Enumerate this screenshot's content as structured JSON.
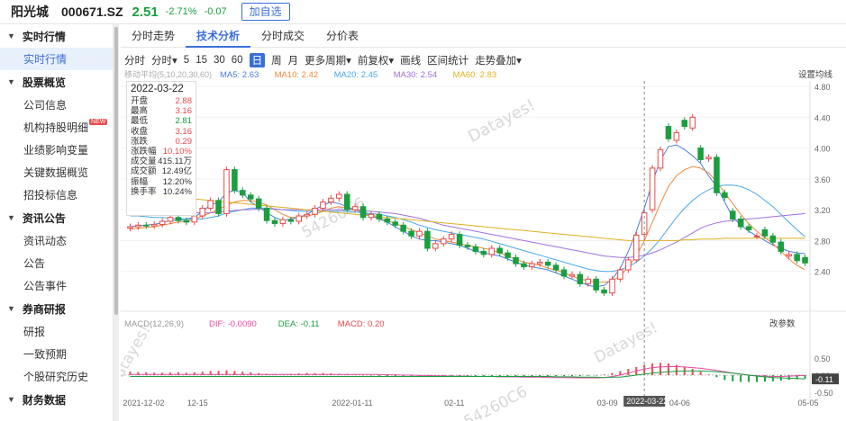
{
  "header": {
    "name": "阳光城",
    "code": "000671.SZ",
    "price": "2.51",
    "change_pct": "-2.71%",
    "change": "-0.07",
    "add_label": "加自选",
    "colors": {
      "down": "#1a9e3f",
      "up": "#e84a4a",
      "accent": "#3b6fd8"
    }
  },
  "sidebar": {
    "sections": [
      {
        "title": "实时行情",
        "items": [
          {
            "label": "实时行情",
            "active": true
          }
        ]
      },
      {
        "title": "股票概览",
        "items": [
          {
            "label": "公司信息"
          },
          {
            "label": "机构持股明细",
            "badge": "NEW"
          },
          {
            "label": "业绩影响变量"
          },
          {
            "label": "关键数据概览"
          },
          {
            "label": "招投标信息"
          }
        ]
      },
      {
        "title": "资讯公告",
        "items": [
          {
            "label": "资讯动态"
          },
          {
            "label": "公告"
          },
          {
            "label": "公告事件"
          }
        ]
      },
      {
        "title": "券商研报",
        "items": [
          {
            "label": "研报"
          },
          {
            "label": "一致预期"
          },
          {
            "label": "个股研究历史"
          }
        ]
      },
      {
        "title": "财务数据",
        "items": []
      }
    ]
  },
  "tabs": [
    {
      "label": "分时走势"
    },
    {
      "label": "技术分析",
      "active": true
    },
    {
      "label": "分时成交"
    },
    {
      "label": "分价表"
    }
  ],
  "periods": [
    {
      "label": "分时"
    },
    {
      "label": "分时▾"
    },
    {
      "label": "5"
    },
    {
      "label": "15"
    },
    {
      "label": "30"
    },
    {
      "label": "60"
    },
    {
      "label": "日",
      "active": true
    },
    {
      "label": "周"
    },
    {
      "label": "月"
    },
    {
      "label": "更多周期▾"
    },
    {
      "label": "前复权▾"
    },
    {
      "label": "画线"
    },
    {
      "label": "区间统计"
    },
    {
      "label": "走势叠加▾"
    }
  ],
  "ma_legend": {
    "label": "移动平均(5,10,20,30,60)",
    "items": [
      {
        "text": "MA5: 2.63",
        "color": "#4a7fd6"
      },
      {
        "text": "MA10: 2.42",
        "color": "#f0883a"
      },
      {
        "text": "MA20: 2.45",
        "color": "#4aa8e8"
      },
      {
        "text": "MA30: 2.54",
        "color": "#a070e0"
      },
      {
        "text": "MA60: 2.83",
        "color": "#e0b020"
      }
    ]
  },
  "settings_label": "设置均线",
  "macd_legend": {
    "label": "MACD(12,26,9)",
    "items": [
      {
        "text": "DIF: -0.0090",
        "color": "#e84aa0"
      },
      {
        "text": "DEA: -0.11",
        "color": "#1a9e3f"
      },
      {
        "text": "MACD: 0.20",
        "color": "#e84a4a"
      }
    ]
  },
  "change_params_label": "改参数",
  "watermark": "Datayes!",
  "watermark_id": "54260C6",
  "crosshair_date": "2022-03-22",
  "macd_readout": "-0.11",
  "infobox": {
    "date": "2022-03-22",
    "rows": [
      {
        "k": "开盘",
        "v": "2.88",
        "c": "r"
      },
      {
        "k": "最高",
        "v": "3.16",
        "c": "r"
      },
      {
        "k": "最低",
        "v": "2.81",
        "c": "g"
      },
      {
        "k": "收盘",
        "v": "3.16",
        "c": "r"
      },
      {
        "k": "涨跌",
        "v": "0.29",
        "c": "r"
      },
      {
        "k": "涨跌幅",
        "v": "10.10%",
        "c": "r"
      },
      {
        "k": "成交量",
        "v": "415.11万",
        "c": "k"
      },
      {
        "k": "成交额",
        "v": "12.49亿",
        "c": "k"
      },
      {
        "k": "振幅",
        "v": "12.20%",
        "c": "k"
      },
      {
        "k": "换手率",
        "v": "10.24%",
        "c": "k"
      }
    ]
  },
  "chart_data": {
    "type": "candlestick",
    "price_axis": {
      "min": 2.0,
      "max": 4.8,
      "ticks": [
        "4.80",
        "4.40",
        "4.00",
        "3.60",
        "3.20",
        "2.80",
        "2.40"
      ]
    },
    "macd_axis": {
      "min": -0.5,
      "max": 0.5,
      "ticks": [
        "0.50",
        "0.00",
        "-0.50"
      ]
    },
    "x_ticks": [
      {
        "i": 0,
        "label": "2021-12-02"
      },
      {
        "i": 8,
        "label": "12-15"
      },
      {
        "i": 26,
        "label": "2022-01-11"
      },
      {
        "i": 40,
        "label": "02-11"
      },
      {
        "i": 59,
        "label": "03-09"
      },
      {
        "i": 68,
        "label": "04-06"
      },
      {
        "i": 84,
        "label": "05-05"
      }
    ],
    "crosshair_index": 64,
    "closes": [
      2.98,
      3.0,
      2.99,
      3.01,
      3.05,
      3.1,
      3.06,
      3.04,
      3.12,
      3.22,
      3.32,
      3.15,
      3.72,
      3.45,
      3.39,
      3.34,
      3.22,
      3.06,
      3.02,
      3.07,
      3.05,
      3.12,
      3.14,
      3.22,
      3.3,
      3.35,
      3.4,
      3.2,
      3.24,
      3.1,
      3.14,
      3.08,
      3.04,
      3.0,
      2.92,
      2.86,
      2.92,
      2.7,
      2.76,
      2.82,
      2.88,
      2.74,
      2.72,
      2.66,
      2.62,
      2.7,
      2.64,
      2.58,
      2.5,
      2.46,
      2.5,
      2.52,
      2.48,
      2.42,
      2.34,
      2.36,
      2.24,
      2.3,
      2.16,
      2.12,
      2.3,
      2.42,
      2.55,
      2.87,
      3.16,
      3.74,
      3.98,
      4.12,
      4.2,
      4.28,
      4.4,
      3.85,
      3.88,
      3.42,
      3.36,
      3.08,
      2.98,
      2.94,
      2.86,
      2.86,
      2.78,
      2.66,
      2.62,
      2.54,
      2.51
    ],
    "opens": [
      2.96,
      2.98,
      3.0,
      2.99,
      3.01,
      3.05,
      3.1,
      3.06,
      3.04,
      3.12,
      3.22,
      3.32,
      3.15,
      3.72,
      3.45,
      3.39,
      3.34,
      3.22,
      3.06,
      3.02,
      3.07,
      3.05,
      3.12,
      3.14,
      3.22,
      3.3,
      3.35,
      3.4,
      3.2,
      3.24,
      3.1,
      3.14,
      3.08,
      3.04,
      3.0,
      2.92,
      2.86,
      2.92,
      2.7,
      2.76,
      2.82,
      2.88,
      2.74,
      2.72,
      2.66,
      2.62,
      2.7,
      2.64,
      2.58,
      2.5,
      2.46,
      2.5,
      2.52,
      2.48,
      2.42,
      2.34,
      2.36,
      2.24,
      2.3,
      2.16,
      2.12,
      2.3,
      2.42,
      2.55,
      2.88,
      3.2,
      3.74,
      4.28,
      4.1,
      4.36,
      4.26,
      4.0,
      3.86,
      3.88,
      3.42,
      3.18,
      3.08,
      2.98,
      2.86,
      2.94,
      2.86,
      2.78,
      2.6,
      2.62,
      2.58
    ],
    "ma_series": [
      {
        "color": "#4a7fd6",
        "values": [
          2.98,
          2.99,
          3.0,
          3.01,
          3.03,
          3.06,
          3.06,
          3.08,
          3.1,
          3.18,
          3.26,
          3.3,
          3.42,
          3.45,
          3.42,
          3.3,
          3.24,
          3.16,
          3.1,
          3.06,
          3.08,
          3.1,
          3.14,
          3.2,
          3.26,
          3.3,
          3.28,
          3.24,
          3.2,
          3.16,
          3.12,
          3.08,
          3.04,
          2.98,
          2.92,
          2.86,
          2.82,
          2.8,
          2.8,
          2.78,
          2.76,
          2.74,
          2.7,
          2.66,
          2.64,
          2.62,
          2.6,
          2.56,
          2.52,
          2.48,
          2.46,
          2.44,
          2.42,
          2.38,
          2.34,
          2.3,
          2.26,
          2.22,
          2.2,
          2.22,
          2.3,
          2.44,
          2.66,
          2.92,
          3.22,
          3.56,
          3.84,
          4.02,
          4.04,
          3.98,
          3.9,
          3.8,
          3.64,
          3.5,
          3.3,
          3.1,
          3.0,
          2.92,
          2.86,
          2.8,
          2.74,
          2.7,
          2.66,
          2.64,
          2.63
        ]
      },
      {
        "color": "#f0883a",
        "values": [
          2.95,
          2.96,
          2.97,
          2.98,
          3.0,
          3.02,
          3.04,
          3.05,
          3.07,
          3.12,
          3.16,
          3.2,
          3.26,
          3.3,
          3.32,
          3.32,
          3.3,
          3.26,
          3.2,
          3.14,
          3.1,
          3.1,
          3.12,
          3.14,
          3.18,
          3.22,
          3.24,
          3.22,
          3.2,
          3.18,
          3.14,
          3.1,
          3.06,
          3.02,
          2.98,
          2.94,
          2.9,
          2.86,
          2.82,
          2.8,
          2.78,
          2.76,
          2.74,
          2.72,
          2.7,
          2.68,
          2.64,
          2.6,
          2.56,
          2.52,
          2.5,
          2.48,
          2.44,
          2.42,
          2.38,
          2.34,
          2.3,
          2.28,
          2.26,
          2.26,
          2.28,
          2.34,
          2.46,
          2.6,
          2.8,
          3.04,
          3.28,
          3.5,
          3.64,
          3.72,
          3.76,
          3.74,
          3.68,
          3.56,
          3.42,
          3.28,
          3.14,
          3.02,
          2.92,
          2.84,
          2.76,
          2.66,
          2.56,
          2.48,
          2.42
        ]
      },
      {
        "color": "#4aa8e8",
        "values": [
          3.12,
          3.12,
          3.11,
          3.1,
          3.1,
          3.09,
          3.08,
          3.08,
          3.07,
          3.08,
          3.1,
          3.12,
          3.16,
          3.18,
          3.2,
          3.22,
          3.22,
          3.22,
          3.21,
          3.2,
          3.19,
          3.18,
          3.18,
          3.18,
          3.18,
          3.18,
          3.18,
          3.18,
          3.17,
          3.16,
          3.15,
          3.14,
          3.12,
          3.1,
          3.07,
          3.04,
          3.0,
          2.97,
          2.94,
          2.92,
          2.9,
          2.88,
          2.86,
          2.84,
          2.82,
          2.79,
          2.76,
          2.73,
          2.7,
          2.67,
          2.64,
          2.61,
          2.58,
          2.55,
          2.52,
          2.49,
          2.46,
          2.43,
          2.41,
          2.4,
          2.4,
          2.42,
          2.46,
          2.52,
          2.6,
          2.7,
          2.82,
          2.96,
          3.1,
          3.22,
          3.32,
          3.4,
          3.46,
          3.5,
          3.52,
          3.52,
          3.5,
          3.46,
          3.4,
          3.32,
          3.24,
          3.14,
          3.04,
          2.94,
          2.85
        ]
      },
      {
        "color": "#a070e0",
        "values": [
          3.2,
          3.2,
          3.19,
          3.19,
          3.18,
          3.18,
          3.17,
          3.17,
          3.16,
          3.16,
          3.16,
          3.17,
          3.18,
          3.19,
          3.2,
          3.2,
          3.21,
          3.21,
          3.21,
          3.2,
          3.2,
          3.2,
          3.2,
          3.2,
          3.2,
          3.2,
          3.2,
          3.2,
          3.2,
          3.19,
          3.18,
          3.17,
          3.16,
          3.15,
          3.13,
          3.11,
          3.09,
          3.06,
          3.03,
          3.0,
          2.98,
          2.96,
          2.94,
          2.92,
          2.9,
          2.88,
          2.86,
          2.84,
          2.82,
          2.8,
          2.78,
          2.76,
          2.74,
          2.72,
          2.7,
          2.68,
          2.66,
          2.64,
          2.62,
          2.6,
          2.59,
          2.58,
          2.58,
          2.59,
          2.61,
          2.64,
          2.68,
          2.73,
          2.78,
          2.84,
          2.9,
          2.96,
          3.0,
          3.03,
          3.05,
          3.06,
          3.07,
          3.08,
          3.09,
          3.1,
          3.11,
          3.12,
          3.13,
          3.14,
          3.15
        ]
      },
      {
        "color": "#e0b020",
        "values": [
          3.42,
          3.41,
          3.4,
          3.39,
          3.38,
          3.37,
          3.36,
          3.35,
          3.34,
          3.33,
          3.32,
          3.31,
          3.3,
          3.29,
          3.28,
          3.27,
          3.26,
          3.25,
          3.24,
          3.23,
          3.22,
          3.21,
          3.2,
          3.19,
          3.18,
          3.17,
          3.16,
          3.15,
          3.14,
          3.13,
          3.12,
          3.11,
          3.1,
          3.09,
          3.08,
          3.07,
          3.06,
          3.05,
          3.04,
          3.03,
          3.02,
          3.01,
          3.0,
          2.99,
          2.98,
          2.97,
          2.96,
          2.95,
          2.94,
          2.93,
          2.92,
          2.91,
          2.9,
          2.89,
          2.88,
          2.87,
          2.86,
          2.85,
          2.84,
          2.83,
          2.82,
          2.81,
          2.8,
          2.8,
          2.8,
          2.8,
          2.8,
          2.8,
          2.8,
          2.81,
          2.81,
          2.82,
          2.82,
          2.82,
          2.83,
          2.83,
          2.83,
          2.83,
          2.83,
          2.83,
          2.83,
          2.83,
          2.83,
          2.83,
          2.83
        ]
      }
    ],
    "macd_hist": [
      0.1,
      0.09,
      0.08,
      0.07,
      0.07,
      0.08,
      0.08,
      0.07,
      0.08,
      0.1,
      0.12,
      0.12,
      0.14,
      0.12,
      0.1,
      0.08,
      0.06,
      0.04,
      0.03,
      0.03,
      0.04,
      0.05,
      0.06,
      0.06,
      0.06,
      0.05,
      0.04,
      0.03,
      0.02,
      0.0,
      -0.01,
      -0.02,
      -0.03,
      -0.03,
      -0.03,
      -0.04,
      -0.04,
      -0.04,
      -0.04,
      -0.04,
      -0.04,
      -0.04,
      -0.04,
      -0.04,
      -0.04,
      -0.04,
      -0.04,
      -0.04,
      -0.04,
      -0.04,
      -0.04,
      -0.04,
      -0.04,
      -0.03,
      -0.03,
      -0.03,
      -0.03,
      -0.02,
      -0.01,
      0.02,
      0.06,
      0.12,
      0.18,
      0.24,
      0.3,
      0.34,
      0.36,
      0.34,
      0.3,
      0.24,
      0.18,
      0.1,
      0.02,
      -0.06,
      -0.14,
      -0.18,
      -0.2,
      -0.2,
      -0.2,
      -0.19,
      -0.18,
      -0.16,
      -0.14,
      -0.12,
      -0.1
    ],
    "dif": [
      0.02,
      0.02,
      0.02,
      0.02,
      0.02,
      0.02,
      0.02,
      0.02,
      0.02,
      0.02,
      0.02,
      0.02,
      0.02,
      0.02,
      0.02,
      0.02,
      0.02,
      0.02,
      0.02,
      0.02,
      0.02,
      0.02,
      0.02,
      0.02,
      0.02,
      0.02,
      0.02,
      0.02,
      0.02,
      0.02,
      0.02,
      0.02,
      0.01,
      0.01,
      0.0,
      0.0,
      -0.01,
      -0.01,
      -0.02,
      -0.02,
      -0.03,
      -0.03,
      -0.03,
      -0.04,
      -0.04,
      -0.04,
      -0.05,
      -0.05,
      -0.05,
      -0.06,
      -0.06,
      -0.06,
      -0.07,
      -0.07,
      -0.07,
      -0.08,
      -0.08,
      -0.08,
      -0.08,
      -0.07,
      -0.04,
      0.0,
      0.06,
      0.12,
      0.18,
      0.22,
      0.24,
      0.25,
      0.25,
      0.24,
      0.22,
      0.2,
      0.17,
      0.14,
      0.1,
      0.06,
      0.03,
      0.0,
      -0.02,
      -0.03,
      -0.04,
      -0.04,
      -0.03,
      -0.02,
      -0.01
    ],
    "dea": [
      -0.04,
      -0.04,
      -0.04,
      -0.04,
      -0.04,
      -0.04,
      -0.04,
      -0.04,
      -0.04,
      -0.04,
      -0.04,
      -0.04,
      -0.04,
      -0.04,
      -0.04,
      -0.04,
      -0.04,
      -0.04,
      -0.04,
      -0.04,
      -0.04,
      -0.04,
      -0.04,
      -0.04,
      -0.04,
      -0.04,
      -0.04,
      -0.04,
      -0.04,
      -0.04,
      -0.04,
      -0.04,
      -0.04,
      -0.04,
      -0.04,
      -0.04,
      -0.04,
      -0.04,
      -0.04,
      -0.04,
      -0.04,
      -0.04,
      -0.04,
      -0.04,
      -0.04,
      -0.04,
      -0.04,
      -0.04,
      -0.04,
      -0.04,
      -0.04,
      -0.04,
      -0.04,
      -0.05,
      -0.05,
      -0.05,
      -0.06,
      -0.06,
      -0.06,
      -0.07,
      -0.06,
      -0.06,
      -0.03,
      0.0,
      0.03,
      0.06,
      0.08,
      0.1,
      0.11,
      0.12,
      0.12,
      0.12,
      0.11,
      0.1,
      0.08,
      0.06,
      0.03,
      0.0,
      -0.03,
      -0.05,
      -0.07,
      -0.08,
      -0.09,
      -0.1,
      -0.11
    ]
  }
}
